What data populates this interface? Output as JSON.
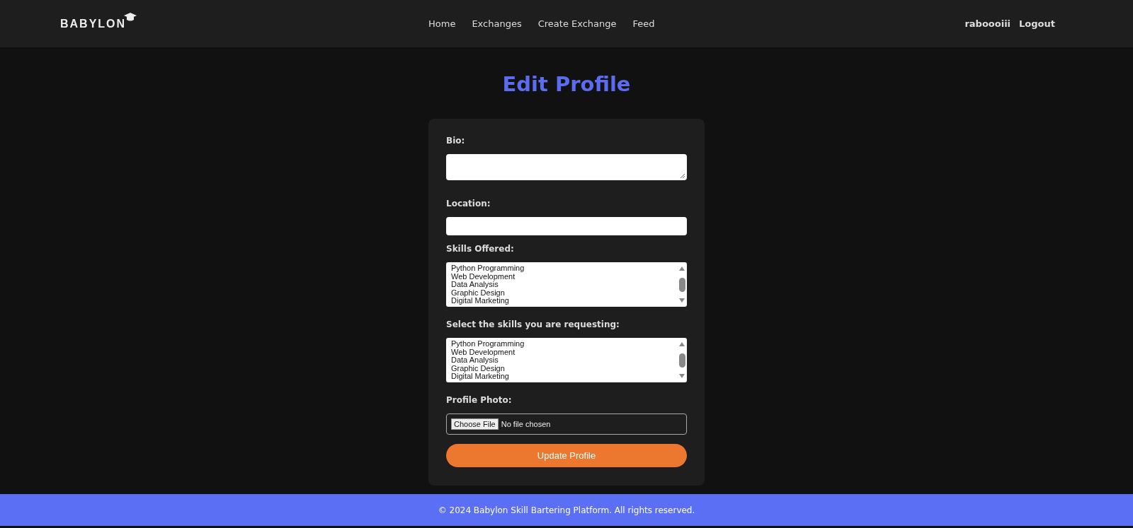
{
  "header": {
    "logo": "BABYLON",
    "nav": [
      {
        "label": "Home"
      },
      {
        "label": "Exchanges"
      },
      {
        "label": "Create Exchange"
      },
      {
        "label": "Feed"
      }
    ],
    "user": "raboooiii",
    "logout": "Logout"
  },
  "title": "Edit Profile",
  "form": {
    "fields": [
      {
        "kind": "textarea",
        "label": "Bio:"
      },
      {
        "kind": "text",
        "label": "Location:"
      },
      {
        "kind": "list",
        "label": "Skills Offered:",
        "options": [
          "Python Programming",
          "Web Development",
          "Data Analysis",
          "Graphic Design",
          "Digital Marketing"
        ]
      },
      {
        "kind": "list",
        "label": "Select the skills you are requesting:",
        "options": [
          "Python Programming",
          "Web Development",
          "Data Analysis",
          "Graphic Design",
          "Digital Marketing"
        ]
      },
      {
        "kind": "file",
        "label": "Profile Photo:",
        "button": "Choose File",
        "status": "No file chosen"
      }
    ],
    "submit": "Update Profile"
  },
  "footer": "© 2024 Babylon Skill Bartering Platform. All rights reserved."
}
